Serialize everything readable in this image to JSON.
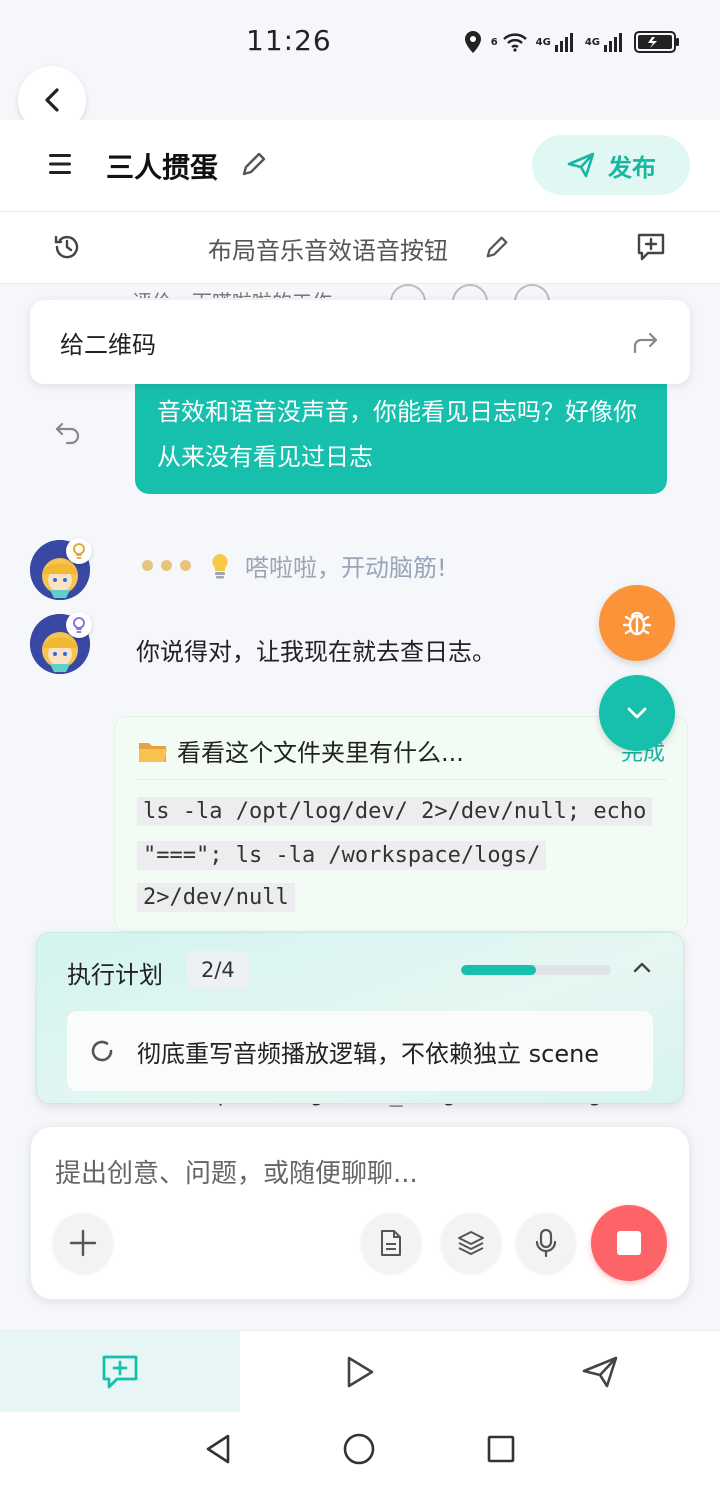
{
  "status_bar": {
    "time": "11:26",
    "network_1": "4G",
    "network_2": "4G",
    "wifi_tag": "6"
  },
  "header": {
    "title": "三人掼蛋",
    "publish_label": "发布"
  },
  "subheader": {
    "title": "布局音乐音效语音按钮"
  },
  "chat": {
    "prev_message_partial": "评价一下嗒啦啦的工作",
    "quick_reply": "给二维码",
    "user_message": "音效和语音没声音，你能看见日志吗？好像你从来没有看见过日志",
    "thinking_text": "嗒啦啦，开动脑筋!",
    "ai_reply": "你说得对，让我现在就去查日志。",
    "tool_call": {
      "title": "看看这个文件夹里有什么...",
      "status": "完成",
      "code_lines": [
        "ls -la /opt/log/dev/ 2>/dev/null; echo",
        "\"===\"; ls -la /workspace/logs/",
        "2>/dev/null"
      ]
    },
    "bg_log_line": "/workspace/logs/lua_diagnostics.log"
  },
  "plan": {
    "title": "执行计划",
    "count": "2/4",
    "progress": 0.5,
    "current_item": "彻底重写音频播放逻辑，不依赖独立 scene"
  },
  "input": {
    "placeholder": "提出创意、问题，或随便聊聊..."
  },
  "colors": {
    "accent": "#16c0ad",
    "bug_button": "#fb9338",
    "stop_button": "#fd6467"
  }
}
